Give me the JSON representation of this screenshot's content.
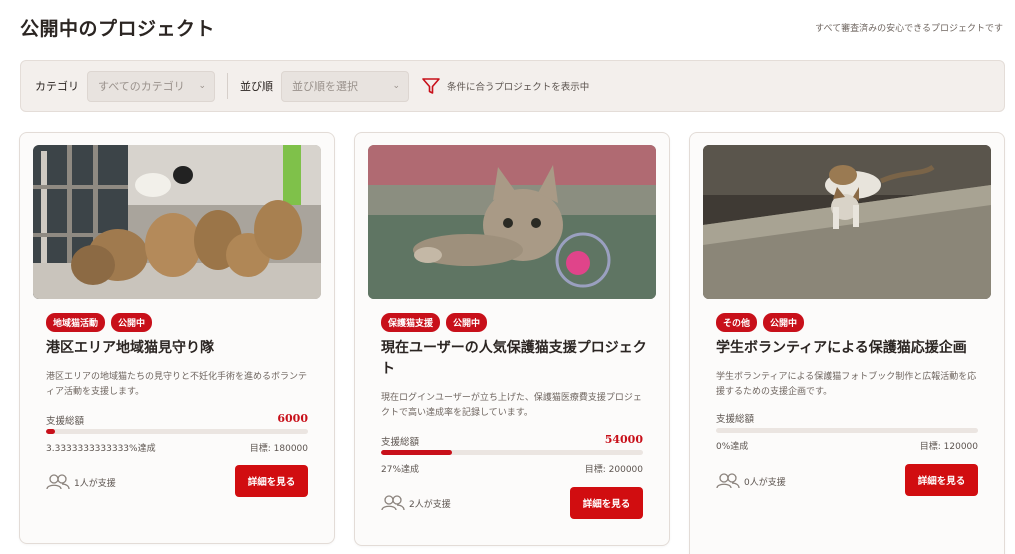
{
  "header": {
    "title": "公開中のプロジェクト",
    "note": "すべて審査済みの安心できるプロジェクトです"
  },
  "filters": {
    "category_label": "カテゴリ",
    "category_value": "すべてのカテゴリ",
    "sort_label": "並び順",
    "sort_value": "並び順を選択",
    "status_text": "条件に合うプロジェクトを表示中"
  },
  "cards": [
    {
      "image": "street-cats-photo",
      "badges": [
        "地域猫活動",
        "公開中"
      ],
      "title": "港区エリア地域猫見守り隊",
      "description": "港区エリアの地域猫たちの見守りと不妊化手術を進めるボランティア活動を支援します。",
      "fund_label": "支援総額",
      "fund_amount": "6000",
      "progress": 0.0333,
      "rate_text": "3.3333333333333%達成",
      "target_text": "目標: 180000",
      "supporters_text": "1人が支援",
      "button_label": "詳細を見る"
    },
    {
      "image": "kitten-playing-photo",
      "badges": [
        "保護猫支援",
        "公開中"
      ],
      "title": "現在ユーザーの人気保護猫支援プロジェクト",
      "description": "現在ログインユーザーが立ち上げた、保護猫医療費支援プロジェクトで高い達成率を記録しています。",
      "fund_label": "支援総額",
      "fund_amount": "54000",
      "progress": 0.27,
      "rate_text": "27%達成",
      "target_text": "目標: 200000",
      "supporters_text": "2人が支援",
      "button_label": "詳細を見る"
    },
    {
      "image": "cat-on-wall-photo",
      "badges": [
        "その他",
        "公開中"
      ],
      "title": "学生ボランティアによる保護猫応援企画",
      "description": "学生ボランティアによる保護猫フォトブック制作と広報活動を応援するための支援企画です。",
      "fund_label": "支援総額",
      "fund_amount": "",
      "progress": 0,
      "rate_text": "0%達成",
      "target_text": "目標: 120000",
      "supporters_text": "0人が支援",
      "button_label": "詳細を見る"
    }
  ],
  "colors": {
    "accent": "#c8101a",
    "panel": "#f3efec"
  }
}
